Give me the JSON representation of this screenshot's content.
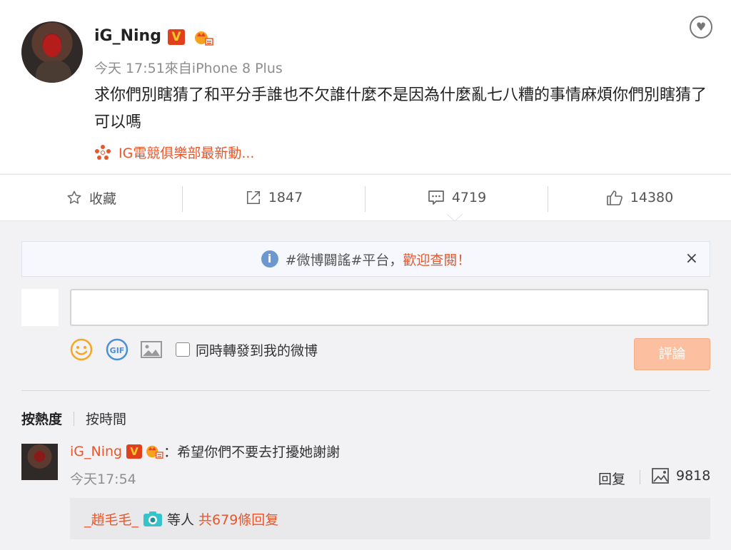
{
  "post": {
    "username": "iG_Ning",
    "v_badge": "V",
    "meta": "今天 17:51來自iPhone 8 Plus",
    "content": "求你們別瞎猜了和平分手誰也不欠誰什麼不是因為什麼亂七八糟的事情麻煩你們別瞎猜了可以嗎",
    "topic": "IG電競俱樂部最新動..."
  },
  "actions": {
    "favorite": "收藏",
    "repost_count": "1847",
    "comment_count": "4719",
    "like_count": "14380"
  },
  "notice": {
    "text": "#微博闢謠#平台，",
    "accent": "歡迎查閱！",
    "close": "×"
  },
  "composer": {
    "repost_label": "同時轉發到我的微博",
    "submit": "評論"
  },
  "sort": {
    "hot": "按熱度",
    "time": "按時間"
  },
  "comment": {
    "username": "iG_Ning",
    "v_badge": "V",
    "text": "：希望你們不要去打擾她謝謝",
    "time": "今天17:54",
    "reply": "回复",
    "likes": "9818",
    "reply_user": "_趙毛毛_",
    "reply_suffix": "等人",
    "reply_total": "共679條回复"
  },
  "colors": {
    "accent": "#e8562a",
    "submit_disabled": "#fcc0a0"
  }
}
